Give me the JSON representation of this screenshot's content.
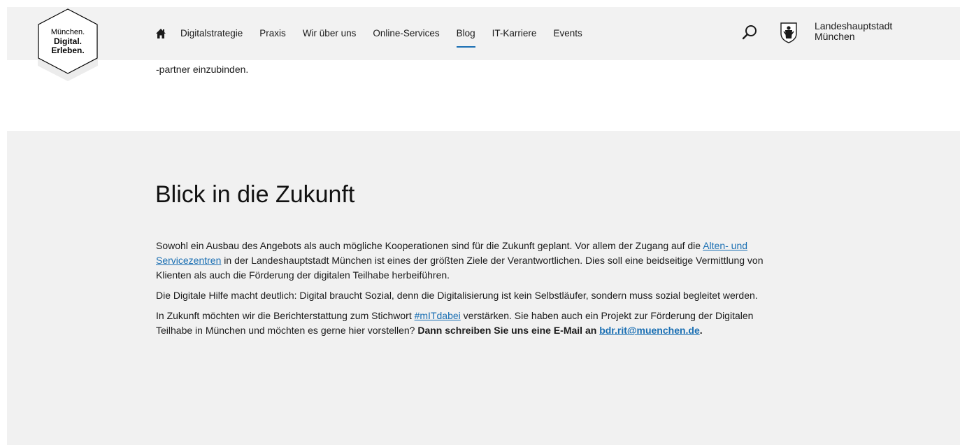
{
  "header": {
    "logo_line1": "München.",
    "logo_line2": "Digital. Erleben.",
    "home_icon": "home-icon",
    "nav_items": [
      {
        "label": "Digitalstrategie",
        "active": false
      },
      {
        "label": "Praxis",
        "active": false
      },
      {
        "label": "Wir über uns",
        "active": false
      },
      {
        "label": "Online-Services",
        "active": false
      },
      {
        "label": "Blog",
        "active": true
      },
      {
        "label": "IT-Karriere",
        "active": false
      },
      {
        "label": "Events",
        "active": false
      }
    ],
    "search_icon": "search-icon",
    "crest_icon": "city-crest-icon",
    "city_line1": "Landeshauptstadt",
    "city_line2": "München",
    "accent_color": "#1a6fb3"
  },
  "intro": {
    "text": "-partner einzubinden."
  },
  "section": {
    "heading": "Blick in die Zukunft",
    "p1": {
      "before_link": "Sowohl ein Ausbau des Angebots als auch mögliche Kooperationen sind für die Zukunft geplant. Vor allem der Zugang auf die ",
      "link": "Alten- und Servicezentren",
      "after_link": " in der Landeshauptstadt München ist eines der größten Ziele der Verantwortlichen. Dies soll eine beidseitige Vermittlung von Klienten als auch die Förderung der digitalen Teilhabe herbeiführen."
    },
    "p2": "Die Digitale Hilfe macht deutlich: Digital braucht Sozial, denn die Digitalisierung ist kein Selbstläufer, sondern muss sozial begleitet werden.",
    "p3": {
      "before_link": "In Zukunft möchten wir die Berichterstattung zum Stichwort ",
      "hashtag_link": "#mITdabei",
      "middle": " verstärken. Sie haben auch ein Projekt zur Förderung der Digitalen Teilhabe in München und möchten es gerne hier vorstellen? ",
      "bold_text": "Dann schreiben Sie uns eine E-Mail an ",
      "email_link": "bdr.rit@muenchen.de",
      "end": "."
    },
    "background_color": "#f1f1f1"
  }
}
